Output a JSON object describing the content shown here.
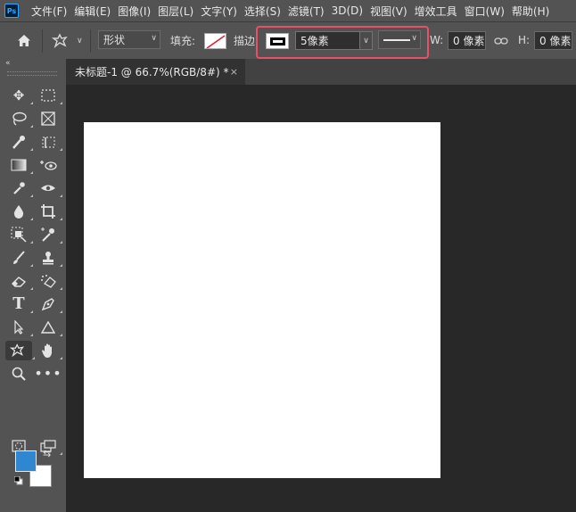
{
  "app": {
    "logo_text": "Ps"
  },
  "menu": [
    "文件(F)",
    "编辑(E)",
    "图像(I)",
    "图层(L)",
    "文字(Y)",
    "选择(S)",
    "滤镜(T)",
    "3D(D)",
    "视图(V)",
    "增效工具",
    "窗口(W)",
    "帮助(H)"
  ],
  "options": {
    "mode_value": "形状",
    "fill_label": "填充:",
    "stroke_label": "描边:",
    "stroke_width_value": "5像素",
    "width_label": "W:",
    "width_value": "0 像素",
    "height_label": "H:",
    "height_value": "0 像素"
  },
  "tools": [
    "move-tool",
    "marquee-tool",
    "lasso-tool",
    "frame-tool",
    "quick-selection-tool",
    "object-selection-tool",
    "gradient-tool",
    "content-aware-tool",
    "eyedropper-tool",
    "eye-dropper-variant-tool",
    "blur-tool",
    "crop-tool",
    "select-subject-tool",
    "color-sampler-tool",
    "brush-tool",
    "clone-stamp-tool",
    "eraser-tool",
    "background-eraser-tool",
    "type-tool",
    "pen-tool",
    "path-selection-tool",
    "triangle-shape-tool",
    "custom-shape-tool",
    "hand-tool",
    "zoom-tool",
    "more-tools",
    "quick-mask-tool",
    "screen-mode-tool"
  ],
  "colors": {
    "foreground": "#2f86d1",
    "background": "#ffffff",
    "highlight": "#e8506a"
  },
  "document": {
    "tab_title": "未标题-1 @ 66.7%(RGB/8#) *",
    "close_glyph": "×"
  }
}
